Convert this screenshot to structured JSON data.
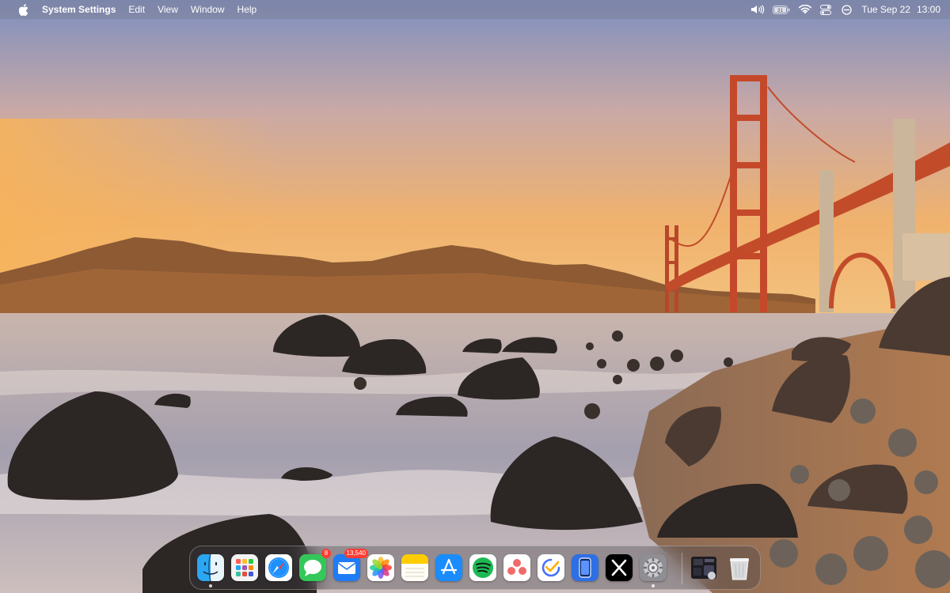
{
  "menubar": {
    "app_name": "System Settings",
    "menus": [
      "Edit",
      "View",
      "Window",
      "Help"
    ],
    "status_icons": [
      "volume-icon",
      "battery-icon",
      "wifi-icon",
      "control-center-icon",
      "focus-icon"
    ],
    "battery_level": "31",
    "date": "Tue Sep 22",
    "time": "13:00"
  },
  "dock": {
    "apps": [
      {
        "name": "finder",
        "running": true
      },
      {
        "name": "launchpad"
      },
      {
        "name": "safari"
      },
      {
        "name": "messages",
        "badge": "8"
      },
      {
        "name": "mail",
        "badge": "13,540"
      },
      {
        "name": "photos"
      },
      {
        "name": "notes"
      },
      {
        "name": "app-store"
      },
      {
        "name": "spotify"
      },
      {
        "name": "asana"
      },
      {
        "name": "ticktick"
      },
      {
        "name": "simulator"
      },
      {
        "name": "x"
      },
      {
        "name": "system-settings",
        "running": true
      }
    ],
    "extras": [
      "downloads-stack",
      "trash"
    ]
  },
  "colors": {
    "sky_top": "#7f93c4",
    "sky_horizon": "#f0b36e",
    "bridge": "#c8502a",
    "sea": "#a9a3ad"
  }
}
